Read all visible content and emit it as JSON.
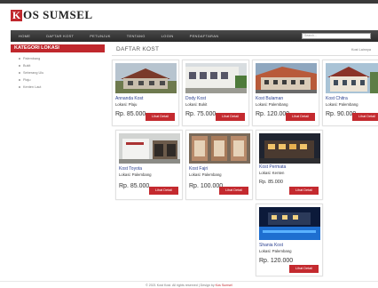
{
  "brand": {
    "logo_letter": "K",
    "logo_text": "OS SUMSEL",
    "accent": "#c0282d"
  },
  "nav": {
    "items": [
      "HOME",
      "DAFTAR KOST",
      "PETUNJUK",
      "TENTANG",
      "LOGIN",
      "PENDAFTARAN"
    ],
    "search_placeholder": "Search..."
  },
  "sidebar": {
    "heading": "KATEGORI LOKASI",
    "items": [
      "Palembang",
      "Bukit",
      "Seberang Ulu",
      "Plaju",
      "Kenten Laut"
    ]
  },
  "main": {
    "title": "DAFTAR KOST",
    "view_all": "Kost Lainnya",
    "button_label": "Lihat Detail",
    "cards": [
      {
        "name": "Annanda Kost",
        "location": "Lokasi: Plaju",
        "price": "Rp. 85.000"
      },
      {
        "name": "Dody Kost",
        "location": "Lokasi: Bukit",
        "price": "Rp. 75.000"
      },
      {
        "name": "Kost Bulaman",
        "location": "Lokasi: Palembang",
        "price": "Rp. 120.000"
      },
      {
        "name": "Kost Chitra",
        "location": "Lokasi: Palembang",
        "price": "Rp. 90.000"
      },
      {
        "name": "Kost Toyota",
        "location": "Lokasi: Palembang",
        "price": "Rp. 85.000"
      },
      {
        "name": "Kost Fajri",
        "location": "Lokasi: Palembang",
        "price": "Rp. 100.000"
      },
      {
        "name": "Kost Permata",
        "location": "Lokasi: Kenten",
        "price": "Rp. 85.000"
      },
      {
        "name": "Shania Kost",
        "location": "Lokasi: Palembang",
        "price": "Rp. 120.000"
      }
    ]
  },
  "footer": {
    "text": "© 2021 Kost Kost. All rights reserved | Design by ",
    "link": "Kos Sumsel"
  }
}
